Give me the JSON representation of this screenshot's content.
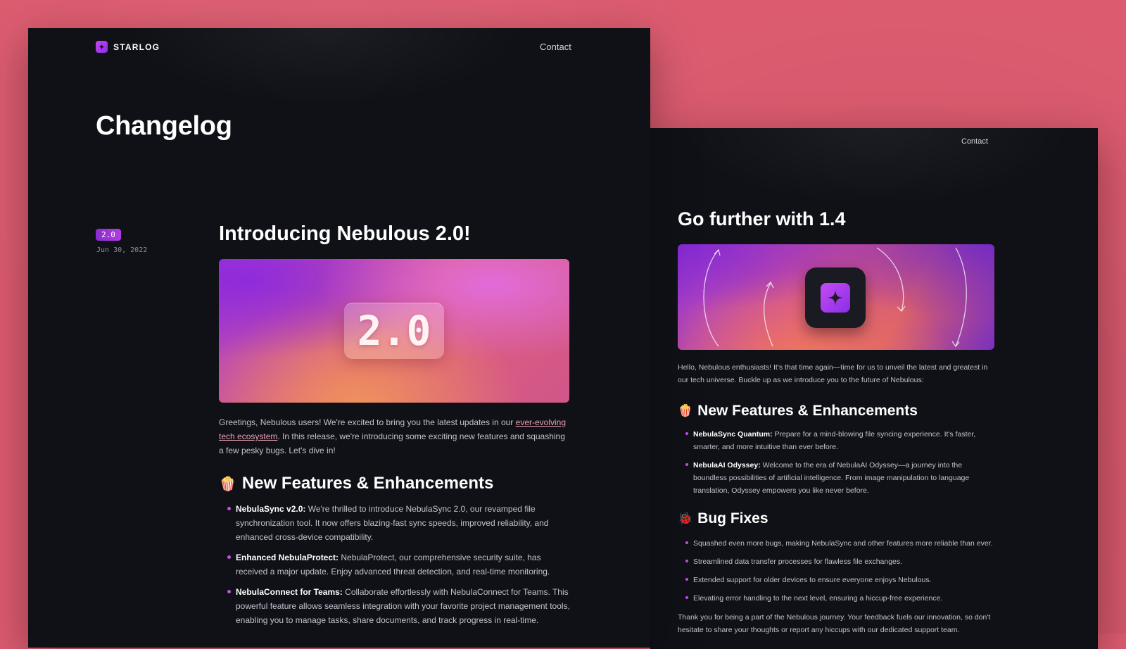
{
  "left_window": {
    "brand": "STARLOG",
    "nav": {
      "contact": "Contact"
    },
    "page_title": "Changelog",
    "entry": {
      "version": "2.0",
      "date": "Jun 30, 2022",
      "title": "Introducing Nebulous 2.0!",
      "hero_text": "2.0",
      "intro_before_link": "Greetings, Nebulous users! We're excited to bring you the latest updates in our ",
      "intro_link": "ever-evolving tech ecosystem",
      "intro_after_link": ". In this release, we're introducing some exciting new features and squashing a few pesky bugs. Let's dive in!",
      "section_heading": "New Features & Enhancements",
      "section_emoji": "🍿",
      "features": [
        {
          "title": "NebulaSync v2.0:",
          "text": " We're thrilled to introduce NebulaSync 2.0, our revamped file synchronization tool. It now offers blazing-fast sync speeds, improved reliability, and enhanced cross-device compatibility."
        },
        {
          "title": "Enhanced NebulaProtect:",
          "text": " NebulaProtect, our comprehensive security suite, has received a major update. Enjoy advanced threat detection, and real-time monitoring."
        },
        {
          "title": "NebulaConnect for Teams:",
          "text": " Collaborate effortlessly with NebulaConnect for Teams. This powerful feature allows seamless integration with your favorite project management tools, enabling you to manage tasks, share documents, and track progress in real-time."
        }
      ]
    }
  },
  "right_window": {
    "nav": {
      "contact": "Contact"
    },
    "entry": {
      "title": "Go further with 1.4",
      "intro": "Hello, Nebulous enthusiasts! It's that time again—time for us to unveil the latest and greatest in our tech universe. Buckle up as we introduce you to the future of Nebulous:",
      "features_heading": "New Features & Enhancements",
      "features_emoji": "🍿",
      "features": [
        {
          "title": "NebulaSync Quantum:",
          "text": " Prepare for a mind-blowing file syncing experience. It's faster, smarter, and more intuitive than ever before."
        },
        {
          "title": "NebulaAI Odyssey:",
          "text": " Welcome to the era of NebulaAI Odyssey—a journey into the boundless possibilities of artificial intelligence. From image manipulation to language translation, Odyssey empowers you like never before."
        }
      ],
      "bugs_heading": "Bug Fixes",
      "bugs_emoji": "🐞",
      "bugs": [
        "Squashed even more bugs, making NebulaSync and other features more reliable than ever.",
        "Streamlined data transfer processes for flawless file exchanges.",
        "Extended support for older devices to ensure everyone enjoys Nebulous.",
        "Elevating error handling to the next level, ensuring a hiccup-free experience."
      ],
      "outro": "Thank you for being a part of the Nebulous journey. Your feedback fuels our innovation, so don't hesitate to share your thoughts or report any hiccups with our dedicated support team."
    }
  }
}
